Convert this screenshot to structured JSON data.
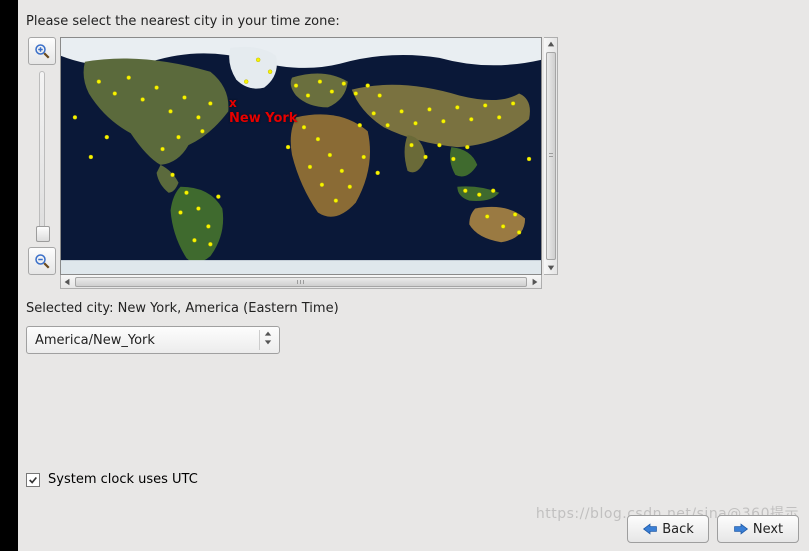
{
  "prompt": "Please select the nearest city in your time zone:",
  "map": {
    "selected_city_marker": "x",
    "selected_city_label": "New York",
    "marker_color": "#e70000",
    "city_dot_color": "#f7f400",
    "ocean_color": "#0a1838"
  },
  "selected": {
    "label_prefix": "Selected city: ",
    "city_text": "New York, America (Eastern Time)"
  },
  "timezone_select": {
    "value": "America/New_York"
  },
  "utc_checkbox": {
    "checked": true,
    "label": "System clock uses UTC"
  },
  "footer": {
    "back": "Back",
    "next": "Next"
  },
  "watermark": "https://blog.csdn.net/sina@360提示"
}
